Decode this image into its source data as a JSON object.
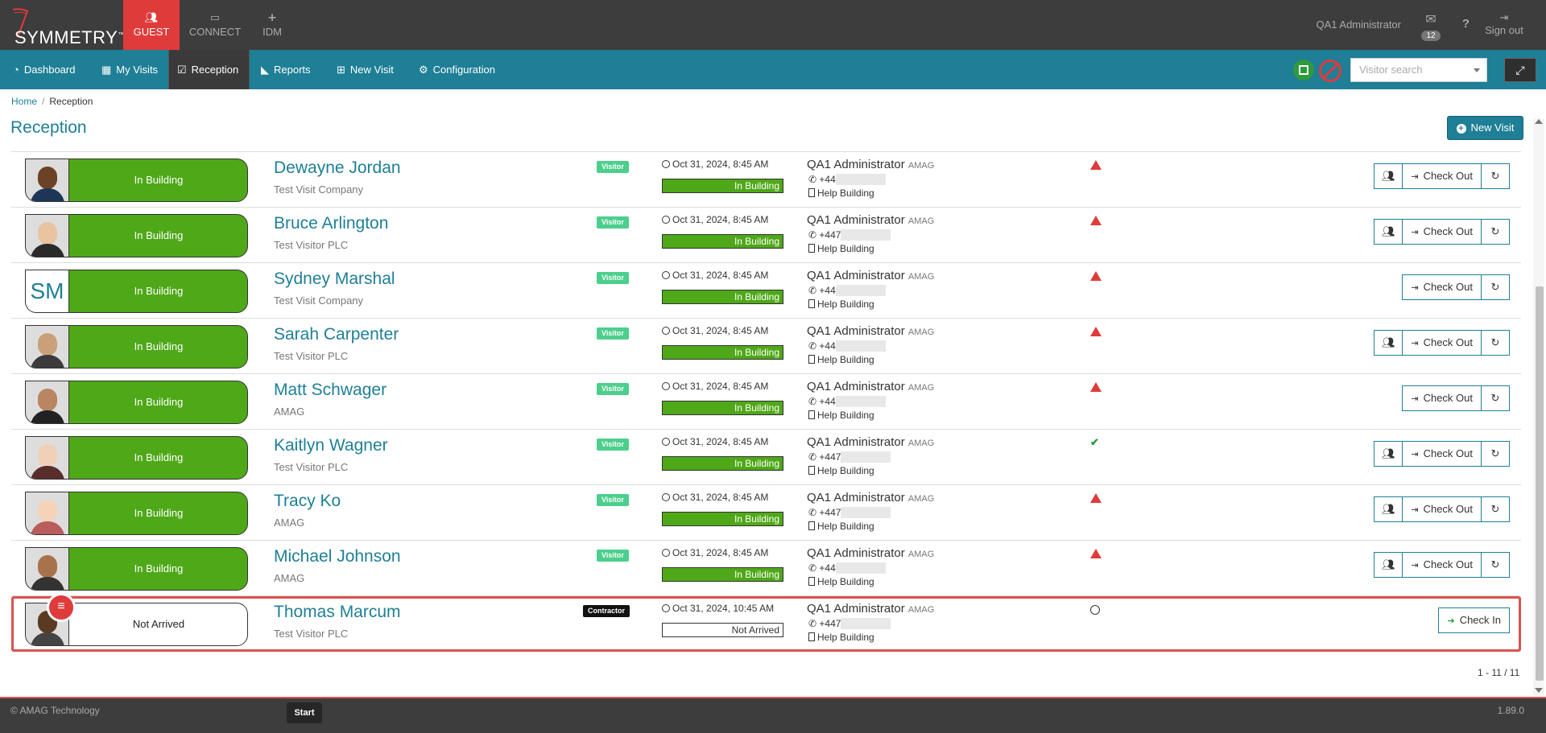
{
  "app": {
    "logo_text": "SYMMETRY",
    "logo_tm": "™",
    "modules": [
      {
        "label": "GUEST",
        "icon": "users-icon"
      },
      {
        "label": "CONNECT",
        "icon": "card-icon"
      },
      {
        "label": "IDM",
        "icon": "user-plus-icon"
      }
    ],
    "user": "QA1 Administrator",
    "mail_count": "12",
    "help": "?",
    "signout": "Sign out"
  },
  "nav": {
    "items": [
      {
        "label": "Dashboard",
        "icon": "tachometer-icon"
      },
      {
        "label": "My Visits",
        "icon": "calendar-icon"
      },
      {
        "label": "Reception",
        "icon": "check-square-icon"
      },
      {
        "label": "Reports",
        "icon": "area-chart-icon"
      },
      {
        "label": "New Visit",
        "icon": "calendar-plus-icon"
      },
      {
        "label": "Configuration",
        "icon": "gear-icon"
      }
    ],
    "search_placeholder": "Visitor search"
  },
  "breadcrumb": {
    "home": "Home",
    "current": "Reception"
  },
  "page": {
    "title": "Reception",
    "new_visit": "New Visit"
  },
  "visits": [
    {
      "status": "In Building",
      "name": "Dewayne Jordan",
      "company": "Test Visit Company",
      "type": "Visitor",
      "time": "Oct 31, 2024, 8:45 AM",
      "state": "In Building",
      "host": "QA1 Administrator",
      "host_org": "AMAG",
      "phone": "+44",
      "building": "Help Building",
      "flag": "warning",
      "group": true,
      "action": "Check Out"
    },
    {
      "status": "In Building",
      "name": "Bruce Arlington",
      "company": "Test Visitor PLC",
      "type": "Visitor",
      "time": "Oct 31, 2024, 8:45 AM",
      "state": "In Building",
      "host": "QA1 Administrator",
      "host_org": "AMAG",
      "phone": "+447",
      "building": "Help Building",
      "flag": "warning",
      "group": true,
      "action": "Check Out"
    },
    {
      "status": "In Building",
      "name": "Sydney Marshal",
      "company": "Test Visit Company",
      "type": "Visitor",
      "time": "Oct 31, 2024, 8:45 AM",
      "state": "In Building",
      "host": "QA1 Administrator",
      "host_org": "AMAG",
      "phone": "+44",
      "building": "Help Building",
      "flag": "warning",
      "group": false,
      "action": "Check Out",
      "initials": "SM"
    },
    {
      "status": "In Building",
      "name": "Sarah Carpenter",
      "company": "Test Visitor PLC",
      "type": "Visitor",
      "time": "Oct 31, 2024, 8:45 AM",
      "state": "In Building",
      "host": "QA1 Administrator",
      "host_org": "AMAG",
      "phone": "+44",
      "building": "Help Building",
      "flag": "warning",
      "group": true,
      "action": "Check Out"
    },
    {
      "status": "In Building",
      "name": "Matt Schwager",
      "company": "AMAG",
      "type": "Visitor",
      "time": "Oct 31, 2024, 8:45 AM",
      "state": "In Building",
      "host": "QA1 Administrator",
      "host_org": "AMAG",
      "phone": "+44",
      "building": "Help Building",
      "flag": "warning",
      "group": false,
      "action": "Check Out"
    },
    {
      "status": "In Building",
      "name": "Kaitlyn Wagner",
      "company": "Test Visitor PLC",
      "type": "Visitor",
      "time": "Oct 31, 2024, 8:45 AM",
      "state": "In Building",
      "host": "QA1 Administrator",
      "host_org": "AMAG",
      "phone": "+447",
      "building": "Help Building",
      "flag": "ok",
      "group": true,
      "action": "Check Out"
    },
    {
      "status": "In Building",
      "name": "Tracy Ko",
      "company": "AMAG",
      "type": "Visitor",
      "time": "Oct 31, 2024, 8:45 AM",
      "state": "In Building",
      "host": "QA1 Administrator",
      "host_org": "AMAG",
      "phone": "+447",
      "building": "Help Building",
      "flag": "warning",
      "group": true,
      "action": "Check Out"
    },
    {
      "status": "In Building",
      "name": "Michael Johnson",
      "company": "AMAG",
      "type": "Visitor",
      "time": "Oct 31, 2024, 8:45 AM",
      "state": "In Building",
      "host": "QA1 Administrator",
      "host_org": "AMAG",
      "phone": "+44",
      "building": "Help Building",
      "flag": "warning",
      "group": true,
      "action": "Check Out"
    },
    {
      "status": "Not Arrived",
      "name": "Thomas Marcum",
      "company": "Test Visitor PLC",
      "type": "Contractor",
      "time": "Oct 31, 2024, 10:45 AM",
      "state": "Not Arrived",
      "host": "QA1 Administrator",
      "host_org": "AMAG",
      "phone": "+447",
      "building": "Help Building",
      "flag": "none",
      "group": false,
      "action": "Check In",
      "alert": true
    }
  ],
  "pager": "1 - 11 / 11",
  "footer": {
    "copyright": "© AMAG Technology",
    "start": "Start",
    "version": "1.89.0"
  },
  "colors": {
    "brand": "#1e7f96",
    "in_building": "#4fa818",
    "alert": "#e03b3b",
    "topbar": "#3d3d3d"
  }
}
